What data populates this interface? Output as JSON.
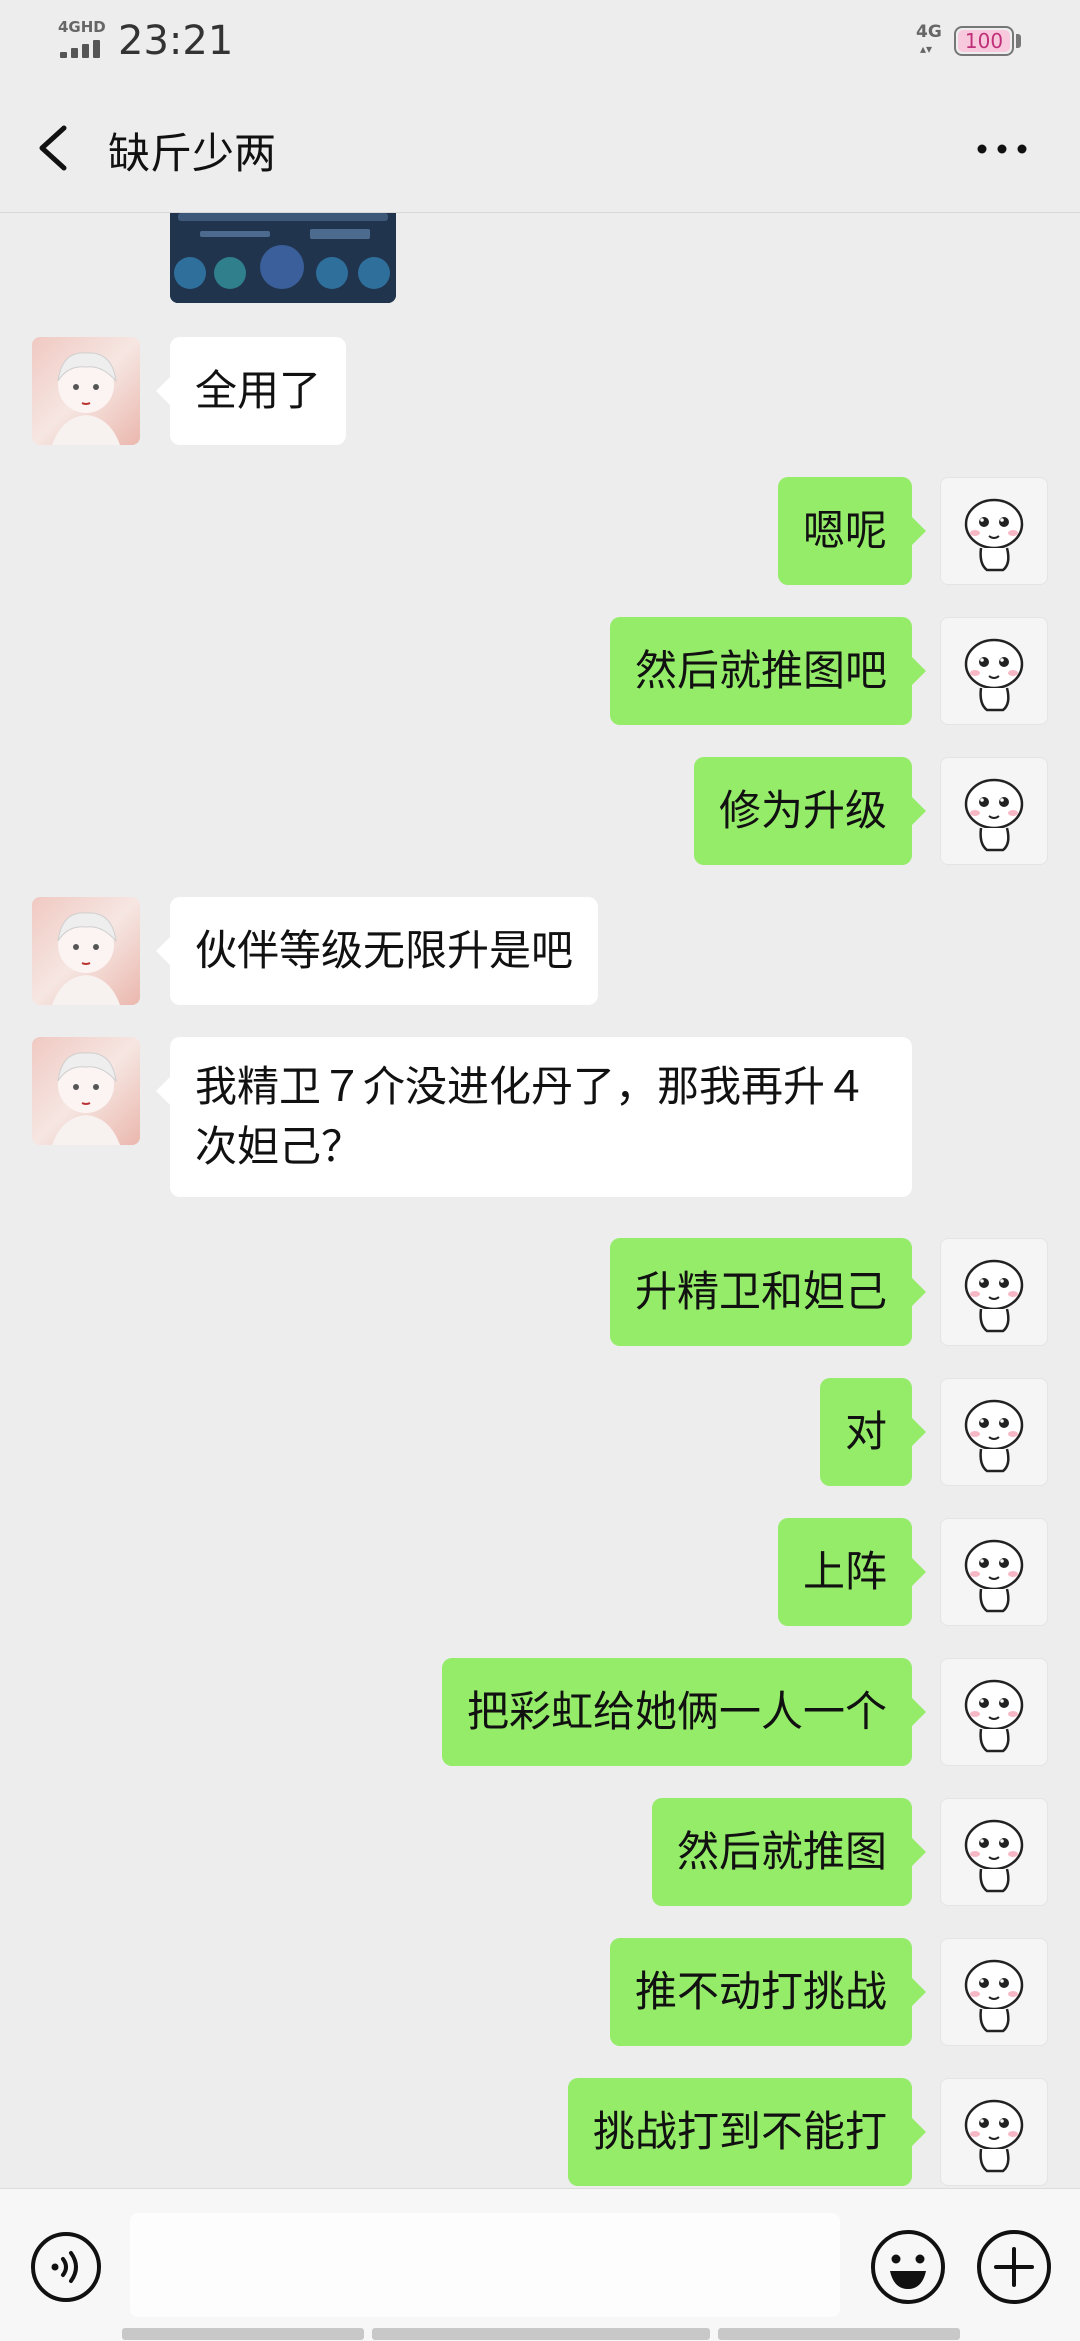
{
  "status_bar": {
    "network": "4GHD",
    "time": "23:21",
    "right_network": "4G",
    "battery": "100"
  },
  "header": {
    "title": "缺斤少两",
    "back_icon": "chevron-left-icon",
    "more_icon": "more-dots-icon"
  },
  "messages": [
    {
      "side": "in",
      "text": "全用了"
    },
    {
      "side": "out",
      "text": "嗯呢"
    },
    {
      "side": "out",
      "text": "然后就推图吧"
    },
    {
      "side": "out",
      "text": "修为升级"
    },
    {
      "side": "in",
      "text": "伙伴等级无限升是吧"
    },
    {
      "side": "in",
      "text": "我精卫７介没进化丹了，那我再升４次妲己？"
    },
    {
      "side": "out",
      "text": "升精卫和妲己"
    },
    {
      "side": "out",
      "text": "对"
    },
    {
      "side": "out",
      "text": "上阵"
    },
    {
      "side": "out",
      "text": "把彩虹给她俩一人一个"
    },
    {
      "side": "out",
      "text": "然后就推图"
    },
    {
      "side": "out",
      "text": "推不动打挑战"
    },
    {
      "side": "out",
      "text": "挑战打到不能打"
    }
  ],
  "input_bar": {
    "voice_icon": "voice-icon",
    "emoji_icon": "emoji-icon",
    "plus_icon": "plus-icon",
    "input_value": ""
  },
  "colors": {
    "background": "#ededed",
    "bubble_out": "#95ec69",
    "bubble_in": "#ffffff"
  }
}
